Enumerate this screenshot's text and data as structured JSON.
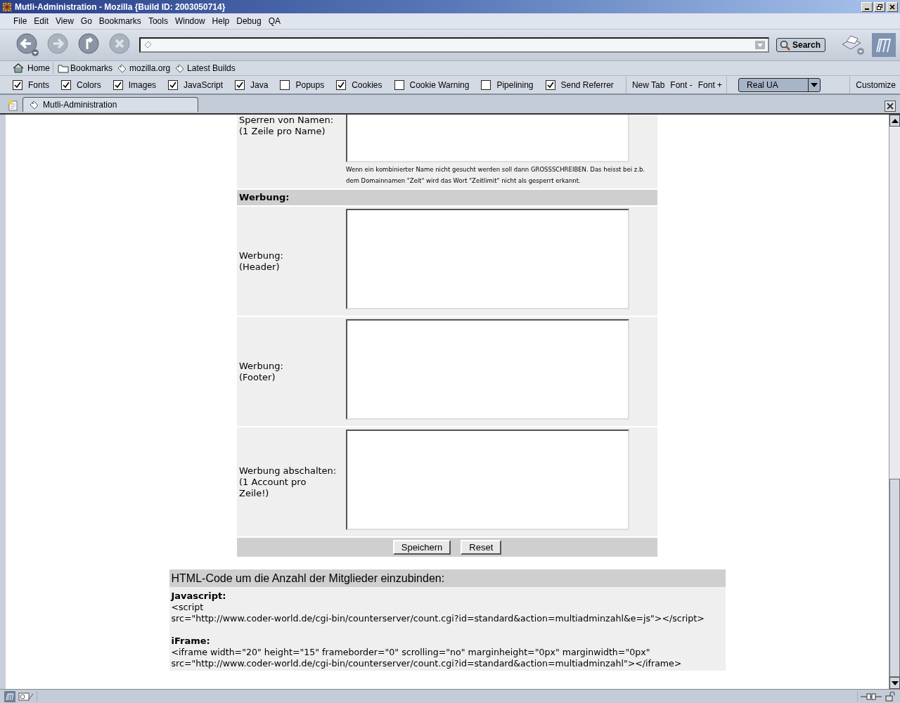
{
  "window": {
    "title": "Mutli-Administration - Mozilla {Build ID: 2003050714}"
  },
  "menu": [
    "File",
    "Edit",
    "View",
    "Go",
    "Bookmarks",
    "Tools",
    "Window",
    "Help",
    "Debug",
    "QA"
  ],
  "nav_toolbar": {
    "search_button": "Search"
  },
  "personal_toolbar": [
    {
      "label": "Home",
      "kind": "home"
    },
    {
      "label": "Bookmarks",
      "kind": "folder"
    },
    {
      "label": "mozilla.org",
      "kind": "link"
    },
    {
      "label": "Latest Builds",
      "kind": "link"
    }
  ],
  "prefbar": {
    "checkboxes": [
      {
        "label": "Fonts",
        "checked": true
      },
      {
        "label": "Colors",
        "checked": true
      },
      {
        "label": "Images",
        "checked": true
      },
      {
        "label": "JavaScript",
        "checked": true
      },
      {
        "label": "Java",
        "checked": true
      },
      {
        "label": "Popups",
        "checked": false
      },
      {
        "label": "Cookies",
        "checked": true
      },
      {
        "label": "Cookie Warning",
        "checked": false
      },
      {
        "label": "Pipelining",
        "checked": false
      },
      {
        "label": "Send Referrer",
        "checked": true
      }
    ],
    "buttons": [
      "New Tab",
      "Font -",
      "Font +"
    ],
    "ua_dropdown": "Real UA",
    "customize": "Customize"
  },
  "tabs": [
    {
      "label": "Mutli-Administration",
      "selected": true
    }
  ],
  "form": {
    "rows": [
      {
        "kind": "field",
        "label": [
          "Sperren von Namen:",
          "(1 Zeile pro Name)"
        ],
        "hint": "Wenn ein kombinierter Name nicht gesucht werden soll dann GROSSSCHREIBEN. Das heisst bei z.b. dem Domainnamen \"Zeit\" wird das Wort \"Zeitlimit\" nicht als gesperrt erkannt."
      },
      {
        "kind": "section",
        "label": [
          "Werbung:"
        ]
      },
      {
        "kind": "field",
        "label": [
          "Werbung:",
          "(Header)"
        ]
      },
      {
        "kind": "field",
        "label": [
          "Werbung:",
          "(Footer)"
        ]
      },
      {
        "kind": "field",
        "label": [
          "Werbung abschalten:",
          "(1 Account pro",
          "Zeile!)"
        ]
      }
    ],
    "buttons": [
      "Speichern",
      "Reset"
    ]
  },
  "code_section": {
    "title": "HTML-Code um die Anzahl der Mitglieder einzubinden:",
    "blocks": [
      {
        "label": "Javascript:",
        "lines": [
          "<script",
          "src=\"http://www.coder-world.de/cgi-bin/counterserver/count.cgi?id=standard&action=multiadminzahl&e=js\"></script>"
        ]
      },
      {
        "label": "iFrame:",
        "lines": [
          "<iframe width=\"20\" height=\"15\" frameborder=\"0\" scrolling=\"no\" marginheight=\"0px\" marginwidth=\"0px\"",
          "src=\"http://www.coder-world.de/cgi-bin/counterserver/count.cgi?id=standard&action=multiadminzahl\"></iframe>"
        ]
      }
    ]
  }
}
